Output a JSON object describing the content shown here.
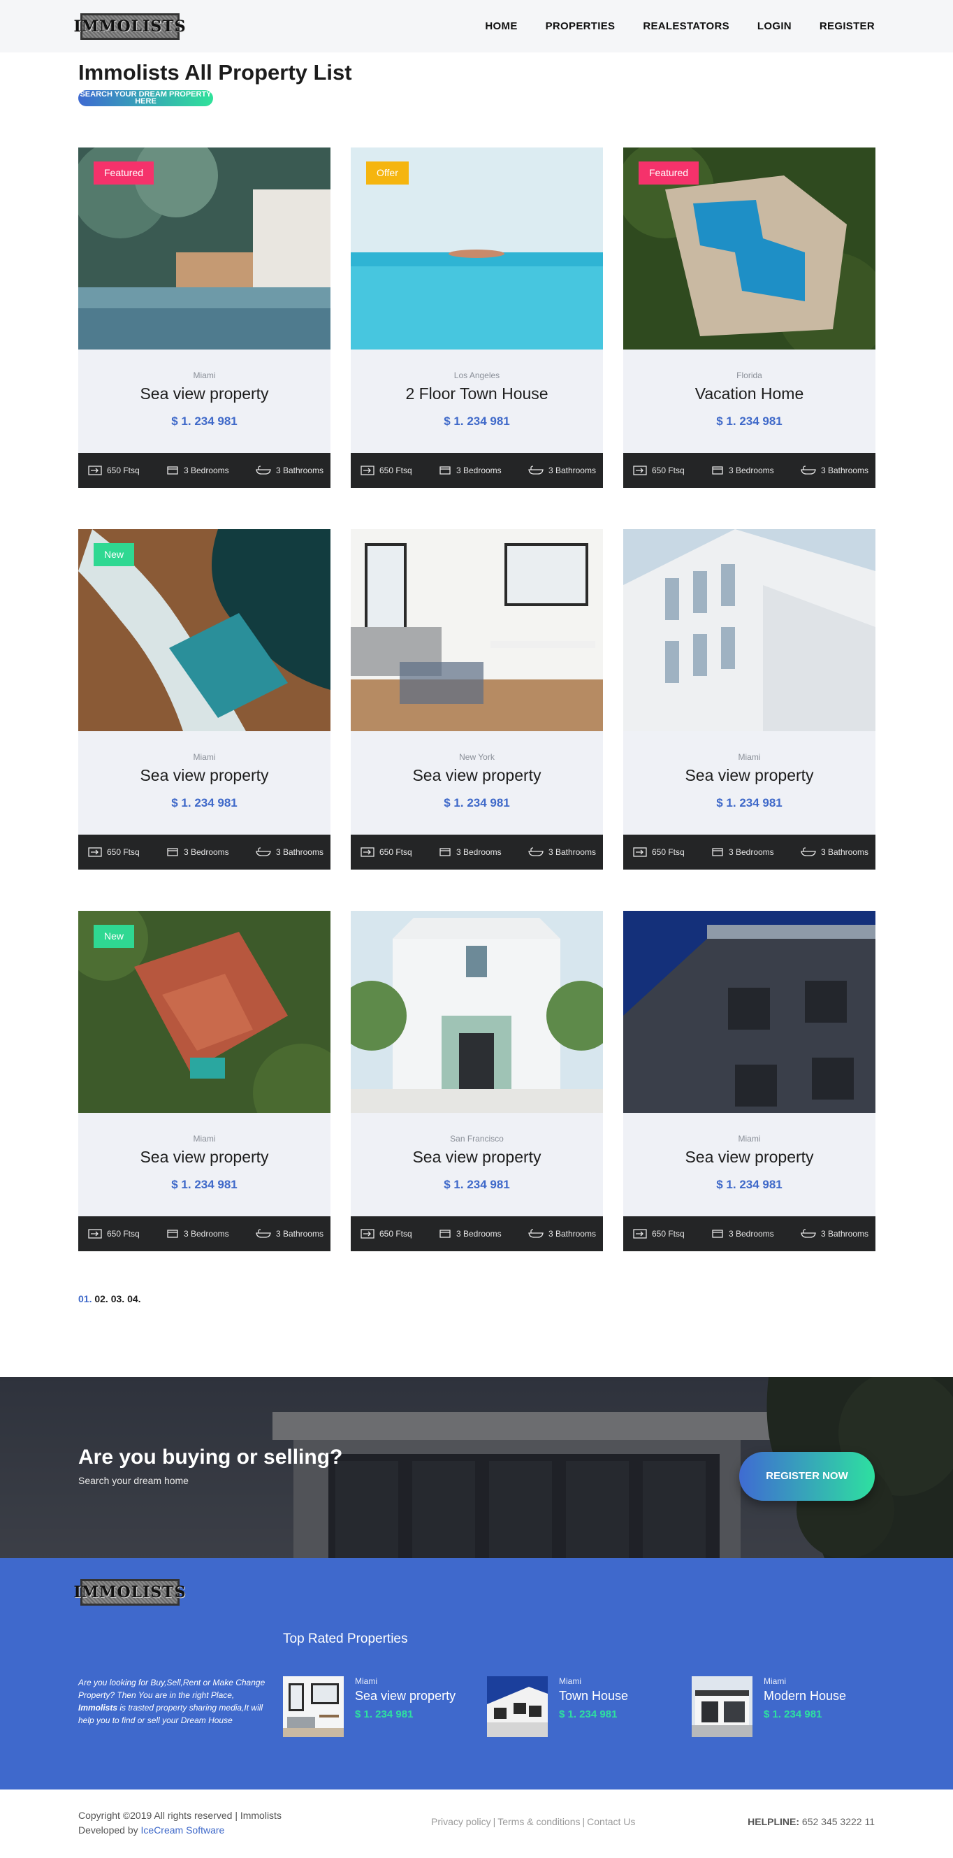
{
  "header": {
    "logo_text": "IMMOLISTS",
    "nav": [
      "HOME",
      "PROPERTIES",
      "REALESTATORS",
      "LOGIN",
      "REGISTER"
    ]
  },
  "page": {
    "title": "Immolists All Property List",
    "search_pill": "SEARCH YOUR DREAM PROPERTY HERE"
  },
  "colors": {
    "accent_blue": "#3f69c9",
    "accent_green": "#2ee0a0",
    "featured_badge": "#f5326b",
    "offer_badge": "#f5b50f",
    "new_badge": "#2fd892",
    "meta_bar": "#242526"
  },
  "properties": [
    {
      "badge": "Featured",
      "badge_color": "#f5326b",
      "city": "Miami",
      "name": "Sea view property",
      "price": "$ 1. 234 981",
      "area": "650 Ftsq",
      "bedrooms": "3 Bedrooms",
      "bathrooms": "3 Bathrooms"
    },
    {
      "badge": "Offer",
      "badge_color": "#f5b50f",
      "city": "Los Angeles",
      "name": "2 Floor Town House",
      "price": "$ 1. 234 981",
      "area": "650 Ftsq",
      "bedrooms": "3 Bedrooms",
      "bathrooms": "3 Bathrooms"
    },
    {
      "badge": "Featured",
      "badge_color": "#f5326b",
      "city": "Florida",
      "name": "Vacation Home",
      "price": "$ 1. 234 981",
      "area": "650 Ftsq",
      "bedrooms": "3 Bedrooms",
      "bathrooms": "3 Bathrooms"
    },
    {
      "badge": "New",
      "badge_color": "#2fd892",
      "city": "Miami",
      "name": "Sea view property",
      "price": "$ 1. 234 981",
      "area": "650 Ftsq",
      "bedrooms": "3 Bedrooms",
      "bathrooms": "3 Bathrooms"
    },
    {
      "badge": "",
      "badge_color": "",
      "city": "New York",
      "name": "Sea view property",
      "price": "$ 1. 234 981",
      "area": "650 Ftsq",
      "bedrooms": "3 Bedrooms",
      "bathrooms": "3 Bathrooms"
    },
    {
      "badge": "",
      "badge_color": "",
      "city": "Miami",
      "name": "Sea view property",
      "price": "$ 1. 234 981",
      "area": "650 Ftsq",
      "bedrooms": "3 Bedrooms",
      "bathrooms": "3 Bathrooms"
    },
    {
      "badge": "New",
      "badge_color": "#2fd892",
      "city": "Miami",
      "name": "Sea view property",
      "price": "$ 1. 234 981",
      "area": "650 Ftsq",
      "bedrooms": "3 Bedrooms",
      "bathrooms": "3 Bathrooms"
    },
    {
      "badge": "",
      "badge_color": "",
      "city": "San Francisco",
      "name": "Sea view property",
      "price": "$ 1. 234 981",
      "area": "650 Ftsq",
      "bedrooms": "3 Bedrooms",
      "bathrooms": "3 Bathrooms"
    },
    {
      "badge": "",
      "badge_color": "",
      "city": "Miami",
      "name": "Sea view property",
      "price": "$ 1. 234 981",
      "area": "650 Ftsq",
      "bedrooms": "3 Bedrooms",
      "bathrooms": "3 Bathrooms"
    }
  ],
  "pagination": {
    "current": "01.",
    "pages": [
      "02.",
      "03.",
      "04."
    ]
  },
  "cta": {
    "title": "Are you buying or selling?",
    "subtitle": "Search your dream home",
    "button": "REGISTER NOW"
  },
  "footer": {
    "logo_text": "IMMOLISTS",
    "about_1": "Are you looking for Buy,Sell,Rent or Make Change Property? Then You are in the right Place, ",
    "about_brand": "Immolists",
    "about_2": " is trasted property sharing media,It will help you to find or sell your Dream House",
    "top_rated_title": "Top Rated Properties",
    "top_rated": [
      {
        "city": "Miami",
        "name": "Sea view property",
        "price": "$ 1. 234 981"
      },
      {
        "city": "Miami",
        "name": "Town House",
        "price": "$ 1. 234 981"
      },
      {
        "city": "Miami",
        "name": "Modern House",
        "price": "$ 1. 234 981"
      }
    ]
  },
  "bottom": {
    "copyright": "Copyright ©2019 All rights reserved | Immolists",
    "developed_by": "Developed by ",
    "developer": "IceCream Software",
    "links": [
      "Privacy policy",
      "Terms & conditions",
      "Contact Us"
    ],
    "helpline_label": "HELPLINE:",
    "helpline_number": "652 345 3222 11"
  }
}
